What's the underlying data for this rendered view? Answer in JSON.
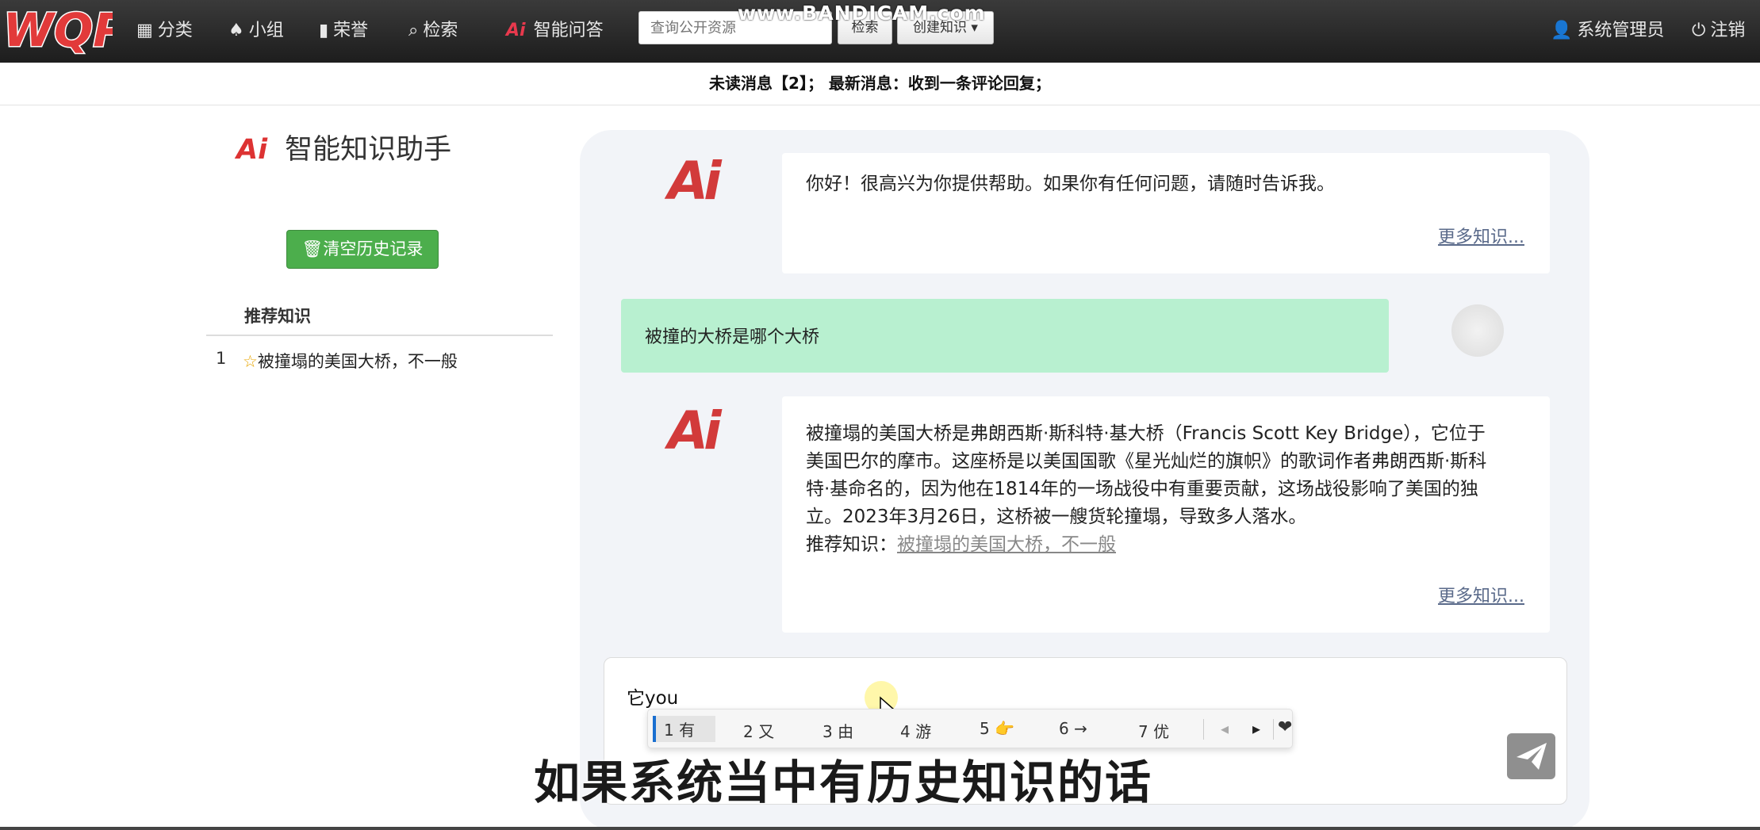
{
  "nav": {
    "logo": "WQP",
    "items": [
      {
        "icon": "grid-icon",
        "label": "分类"
      },
      {
        "icon": "tree-icon",
        "label": "小组"
      },
      {
        "icon": "bar-chart-icon",
        "label": "荣誉"
      },
      {
        "icon": "search-icon",
        "label": "检索"
      },
      {
        "icon": "ai-icon",
        "label": "智能问答"
      }
    ],
    "search_placeholder": "查询公开资源",
    "search_button": "检索",
    "create_button": "创建知识",
    "user_label": "系统管理员",
    "logout_label": "注销",
    "watermark": "www.BANDICAM.com"
  },
  "notice": "未读消息【2】； 最新消息：收到一条评论回复；",
  "sidebar": {
    "title": "智能知识助手",
    "clear_button": "清空历史记录",
    "recommend_header": "推荐知识",
    "items": [
      {
        "num": "1",
        "label": "被撞塌的美国大桥，不一般"
      }
    ]
  },
  "chat": {
    "messages": [
      {
        "role": "ai",
        "text": "你好！很高兴为你提供帮助。如果你有任何问题，请随时告诉我。",
        "more": "更多知识..."
      },
      {
        "role": "user",
        "text": "被撞的大桥是哪个大桥"
      },
      {
        "role": "ai",
        "lines": [
          "被撞塌的美国大桥是弗朗西斯·斯科特·基大桥（Francis Scott Key Bridge），它位于",
          "美国巴尔的摩市。这座桥是以美国国歌《星光灿烂的旗帜》的歌词作者弗朗西斯·斯科",
          "特·基命名的，因为他在1814年的一场战役中有重要贡献，这场战役影响了美国的独",
          "立。2023年3月26日，这桥被一艘货轮撞塌，导致多人落水。"
        ],
        "rec_label": "推荐知识：",
        "rec_link": "被撞塌的美国大桥，不一般",
        "more": "更多知识..."
      }
    ],
    "input_value": "它you",
    "ime_candidates": [
      "1 有",
      "2 又",
      "3 由",
      "4 游",
      "5 👉",
      "6 →",
      "7 优"
    ]
  },
  "subtitle": "如果系统当中有历史知识的话"
}
